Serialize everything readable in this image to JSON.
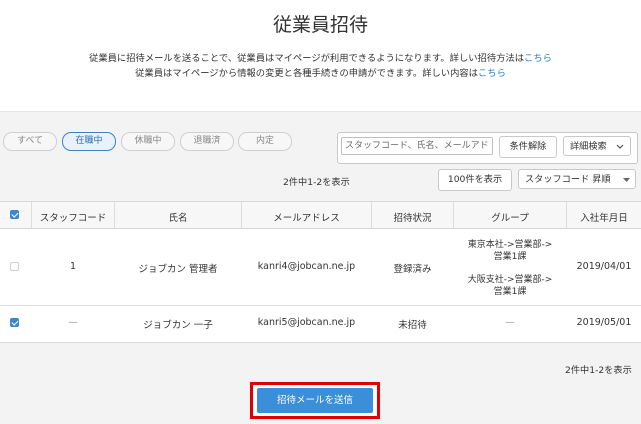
{
  "header": {
    "title": "従業員招待",
    "desc_line1": "従業員に招待メールを送ることで、従業員はマイページが利用できるようになります。詳しい招待方法は",
    "desc_line1_link": "こちら",
    "desc_line2": "従業員はマイページから情報の変更と各種手続きの申請ができます。詳しい内容は",
    "desc_line2_link": "こちら"
  },
  "filters": {
    "tabs": [
      {
        "label": "すべて",
        "active": false
      },
      {
        "label": "在職中",
        "active": true
      },
      {
        "label": "休職中",
        "active": false
      },
      {
        "label": "退職済",
        "active": false
      },
      {
        "label": "内定",
        "active": false
      }
    ]
  },
  "search": {
    "placeholder": "スタッフコード、氏名、メールアドレス",
    "clear_label": "条件解除",
    "advanced_label": "詳細検索"
  },
  "list_controls": {
    "count_text": "2件中1-2を表示",
    "per_page_label": "100件を表示",
    "sort_label": "スタッフコード 昇順"
  },
  "table": {
    "headers": [
      "スタッフコード",
      "氏名",
      "メールアドレス",
      "招待状況",
      "グループ",
      "入社年月日"
    ],
    "rows": [
      {
        "checked": false,
        "code": "1",
        "name": "ジョブカン 管理者",
        "email": "kanri4@jobcan.ne.jp",
        "status": "登録済み",
        "group": [
          "東京本社->営業部->",
          "営業1課",
          "大阪支社->営業部->",
          "営業1課"
        ],
        "join_date": "2019/04/01"
      },
      {
        "checked": true,
        "code": "—",
        "name": "ジョブカン 一子",
        "email": "kanri5@jobcan.ne.jp",
        "status": "未招待",
        "group": [
          "—"
        ],
        "join_date": "2019/05/01"
      }
    ]
  },
  "footer": {
    "count_text": "2件中1-2を表示",
    "send_label": "招待メールを送信"
  },
  "colors": {
    "link": "#2b7fc3",
    "primary_button": "#3b8fd9",
    "highlight_frame": "#e10000"
  }
}
